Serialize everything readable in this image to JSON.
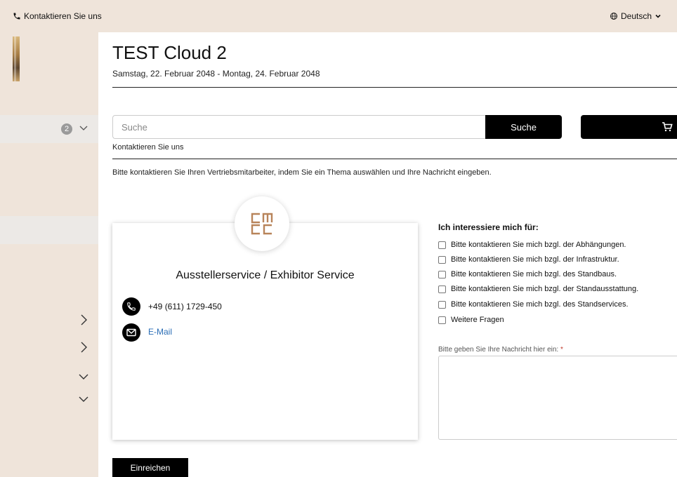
{
  "topbar": {
    "contact_label": "Kontaktieren Sie uns",
    "language_label": "Deutsch"
  },
  "sidebar": {
    "count_badge": "2"
  },
  "event": {
    "title": "TEST Cloud 2",
    "dates": "Samstag, 22. Februar 2048 - Montag, 24. Februar 2048"
  },
  "search": {
    "placeholder": "Suche",
    "button_label": "Suche"
  },
  "breadcrumb": "Kontaktieren Sie uns",
  "intro_text": "Bitte kontaktieren Sie Ihren Vertriebsmitarbeiter, indem Sie ein Thema auswählen und Ihre Nachricht eingeben.",
  "contact_card": {
    "title": "Ausstellerservice / Exhibitor Service",
    "phone": "+49 (611) 1729-450",
    "email_label": "E-Mail"
  },
  "interests": {
    "title": "Ich interessiere mich für:",
    "options": [
      "Bitte kontaktieren Sie mich bzgl. der Abhängungen.",
      "Bitte kontaktieren Sie mich bzgl. der Infrastruktur.",
      "Bitte kontaktieren Sie mich bzgl. des Standbaus.",
      "Bitte kontaktieren Sie mich bzgl. der Standausstattung.",
      "Bitte kontaktieren Sie mich bzgl. des Standservices.",
      "Weitere Fragen"
    ]
  },
  "message": {
    "label": "Bitte geben Sie Ihre Nachricht hier ein:",
    "required_mark": "*"
  },
  "submit_label": "Einreichen",
  "colors": {
    "sand": "#efe4da",
    "black": "#000000",
    "link": "#2a6db5",
    "required": "#c0392b"
  }
}
